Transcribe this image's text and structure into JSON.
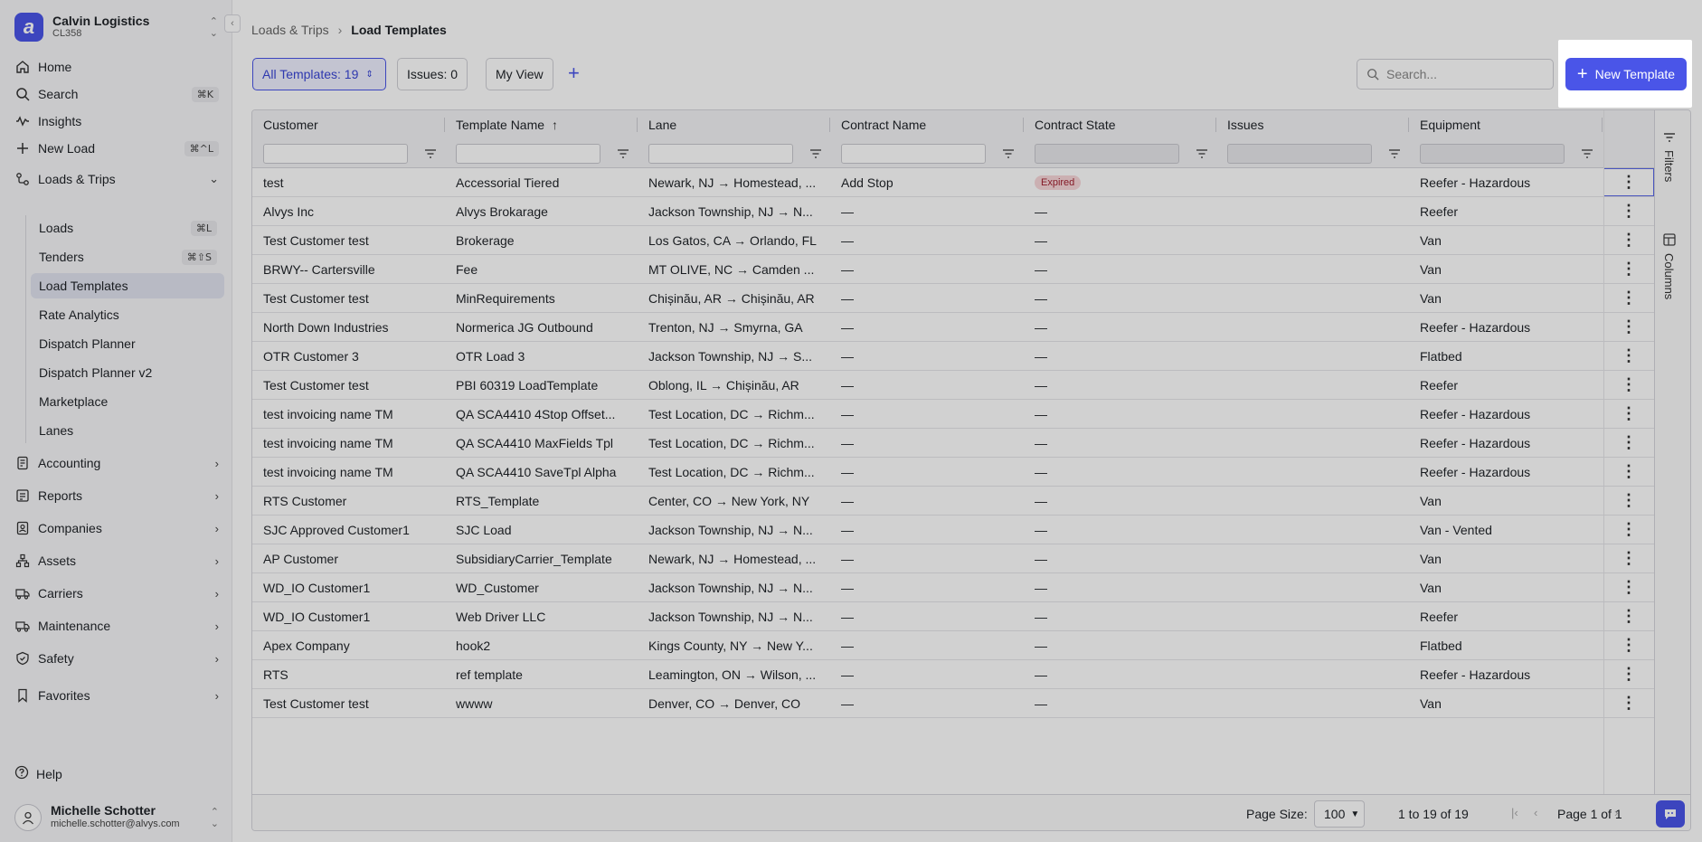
{
  "org": {
    "name": "Calvin Logistics",
    "code": "CL358",
    "logo_letter": "a"
  },
  "nav": {
    "home": {
      "label": "Home"
    },
    "search": {
      "label": "Search",
      "shortcut": "⌘K"
    },
    "insights": {
      "label": "Insights"
    },
    "new_load": {
      "label": "New Load",
      "shortcut": "⌘^L"
    },
    "loads_trips": {
      "label": "Loads & Trips"
    },
    "sub_items": [
      {
        "label": "Loads",
        "shortcut": "⌘L"
      },
      {
        "label": "Tenders",
        "shortcut": "⌘⇧S"
      },
      {
        "label": "Load Templates",
        "shortcut": ""
      },
      {
        "label": "Rate Analytics",
        "shortcut": ""
      },
      {
        "label": "Dispatch Planner",
        "shortcut": ""
      },
      {
        "label": "Dispatch Planner v2",
        "shortcut": ""
      },
      {
        "label": "Marketplace",
        "shortcut": ""
      },
      {
        "label": "Lanes",
        "shortcut": ""
      }
    ],
    "sections": [
      {
        "label": "Accounting"
      },
      {
        "label": "Reports"
      },
      {
        "label": "Companies"
      },
      {
        "label": "Assets"
      },
      {
        "label": "Carriers"
      },
      {
        "label": "Maintenance"
      },
      {
        "label": "Safety"
      },
      {
        "label": "Favorites"
      }
    ],
    "help": {
      "label": "Help"
    }
  },
  "user": {
    "name": "Michelle Schotter",
    "email": "michelle.schotter@alvys.com"
  },
  "breadcrumb": {
    "parent": "Loads & Trips",
    "current": "Load Templates"
  },
  "toolbar": {
    "all_templates": "All Templates: 19",
    "issues": "Issues: 0",
    "my_view": "My View",
    "search_placeholder": "Search...",
    "new_template": "New Template"
  },
  "table": {
    "columns": [
      "Customer",
      "Template Name",
      "Lane",
      "Contract Name",
      "Contract State",
      "Issues",
      "Equipment"
    ],
    "rows": [
      [
        "test",
        "Accessorial Tiered",
        "Newark, NJ → Homestead, ...",
        "Add Stop",
        "Expired",
        "",
        "Reefer - Hazardous"
      ],
      [
        "Alvys Inc",
        "Alvys Brokarage",
        "Jackson Township, NJ → N...",
        "—",
        "—",
        "",
        "Reefer"
      ],
      [
        "Test Customer test",
        "Brokerage",
        "Los Gatos, CA → Orlando, FL",
        "—",
        "—",
        "",
        "Van"
      ],
      [
        "BRWY-- Cartersville",
        "Fee",
        "MT OLIVE, NC → Camden ...",
        "—",
        "—",
        "",
        "Van"
      ],
      [
        "Test Customer test",
        "MinRequirements",
        "Chișinău, AR → Chișinău, AR",
        "—",
        "—",
        "",
        "Van"
      ],
      [
        "North Down Industries",
        "Normerica JG Outbound",
        "Trenton, NJ → Smyrna, GA",
        "—",
        "—",
        "",
        "Reefer - Hazardous"
      ],
      [
        "OTR Customer 3",
        "OTR Load 3",
        "Jackson Township, NJ → S...",
        "—",
        "—",
        "",
        "Flatbed"
      ],
      [
        "Test Customer test",
        "PBI 60319 LoadTemplate",
        "Oblong, IL → Chișinău, AR",
        "—",
        "—",
        "",
        "Reefer"
      ],
      [
        "test invoicing name TM",
        "QA SCA4410 4Stop Offset...",
        "Test Location, DC → Richm...",
        "—",
        "—",
        "",
        "Reefer - Hazardous"
      ],
      [
        "test invoicing name TM",
        "QA SCA4410 MaxFields Tpl",
        "Test Location, DC → Richm...",
        "—",
        "—",
        "",
        "Reefer - Hazardous"
      ],
      [
        "test invoicing name TM",
        "QA SCA4410 SaveTpl Alpha",
        "Test Location, DC → Richm...",
        "—",
        "—",
        "",
        "Reefer - Hazardous"
      ],
      [
        "RTS Customer",
        "RTS_Template",
        "Center, CO → New York, NY",
        "—",
        "—",
        "",
        "Van"
      ],
      [
        "SJC Approved Customer1",
        "SJC Load",
        "Jackson Township, NJ → N...",
        "—",
        "—",
        "",
        "Van - Vented"
      ],
      [
        "AP Customer",
        "SubsidiaryCarrier_Template",
        "Newark, NJ → Homestead, ...",
        "—",
        "—",
        "",
        "Van"
      ],
      [
        "WD_IO Customer1",
        "WD_Customer",
        "Jackson Township, NJ → N...",
        "—",
        "—",
        "",
        "Van"
      ],
      [
        "WD_IO Customer1",
        "Web Driver LLC",
        "Jackson Township, NJ → N...",
        "—",
        "—",
        "",
        "Reefer"
      ],
      [
        "Apex Company",
        "hook2",
        "Kings County, NY → New Y...",
        "—",
        "—",
        "",
        "Flatbed"
      ],
      [
        "RTS",
        "ref template",
        "Leamington, ON → Wilson, ...",
        "—",
        "—",
        "",
        "Reefer - Hazardous"
      ],
      [
        "Test Customer test",
        "wwww",
        "Denver, CO → Denver, CO",
        "—",
        "—",
        "",
        "Van"
      ]
    ]
  },
  "side_panel": {
    "filters": "Filters",
    "columns": "Columns"
  },
  "footer": {
    "page_size_label": "Page Size:",
    "page_size": "100",
    "range": "1 to 19 of 19",
    "page": "Page 1 of 1"
  },
  "colors": {
    "accent": "#4a55e8",
    "expired_bg": "#f8d7da",
    "expired_text": "#a32030"
  }
}
